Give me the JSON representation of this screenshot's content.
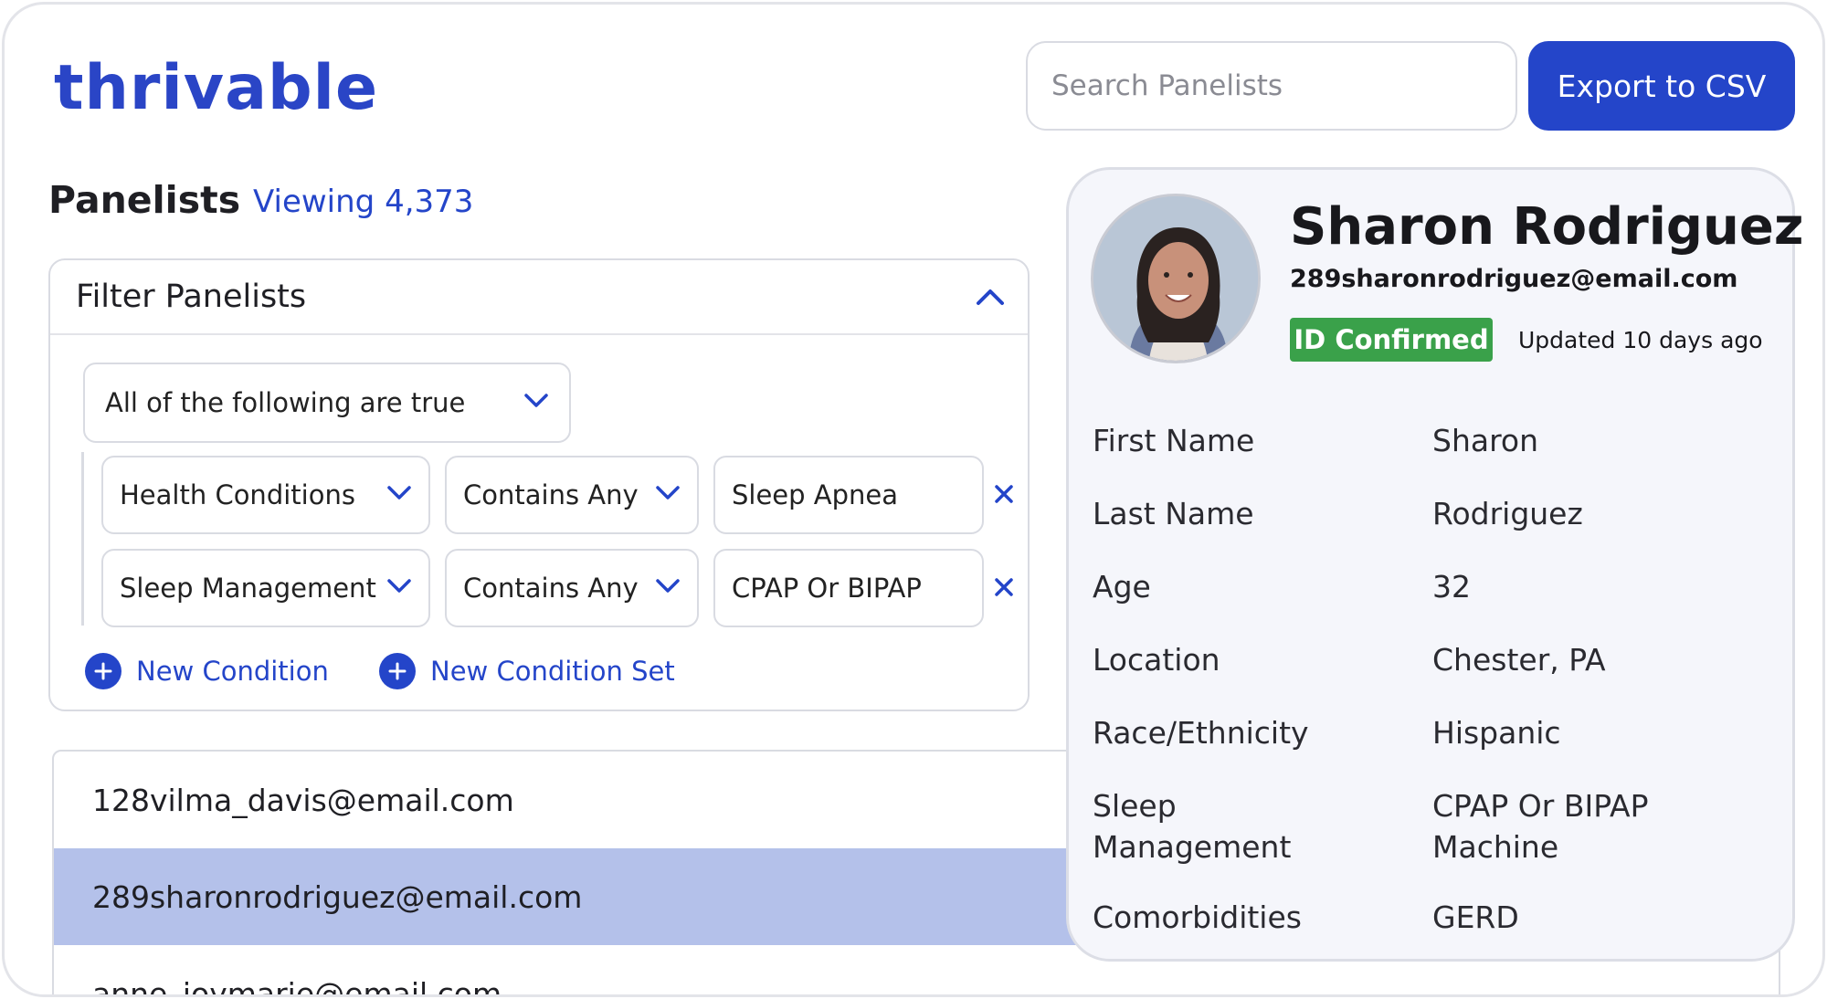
{
  "brand": {
    "logo_text": "thrivable",
    "accent_color": "#2445c9"
  },
  "header": {
    "search_placeholder": "Search Panelists",
    "export_label": "Export to CSV"
  },
  "page": {
    "title": "Panelists",
    "viewing_text": "Viewing 4,373"
  },
  "filter": {
    "title": "Filter Panelists",
    "logic_value": "All of the following are true",
    "conditions": [
      {
        "field": "Health Conditions",
        "operator": "Contains Any",
        "value": "Sleep Apnea"
      },
      {
        "field": "Sleep Management",
        "operator": "Contains Any",
        "value": "CPAP Or BIPAP"
      }
    ],
    "new_condition_label": "New Condition",
    "new_condition_set_label": "New Condition Set"
  },
  "list": {
    "rows": [
      {
        "email": "128vilma_davis@email.com",
        "selected": false
      },
      {
        "email": "289sharonrodriguez@email.com",
        "selected": true
      },
      {
        "email": "anne_joymarie@email.com",
        "selected": false
      }
    ]
  },
  "profile": {
    "name": "Sharon Rodriguez",
    "email": "289sharonrodriguez@email.com",
    "badge": "ID Confirmed",
    "badge_color": "#3aa14a",
    "updated": "Updated 10 days ago",
    "details": [
      {
        "label": "First Name",
        "value": "Sharon"
      },
      {
        "label": "Last Name",
        "value": "Rodriguez"
      },
      {
        "label": "Age",
        "value": "32"
      },
      {
        "label": "Location",
        "value": "Chester, PA"
      },
      {
        "label": "Race/Ethnicity",
        "value": "Hispanic"
      },
      {
        "label": "Sleep Management",
        "value": "CPAP Or BIPAP Machine"
      },
      {
        "label": "Comorbidities",
        "value": "GERD"
      }
    ]
  }
}
